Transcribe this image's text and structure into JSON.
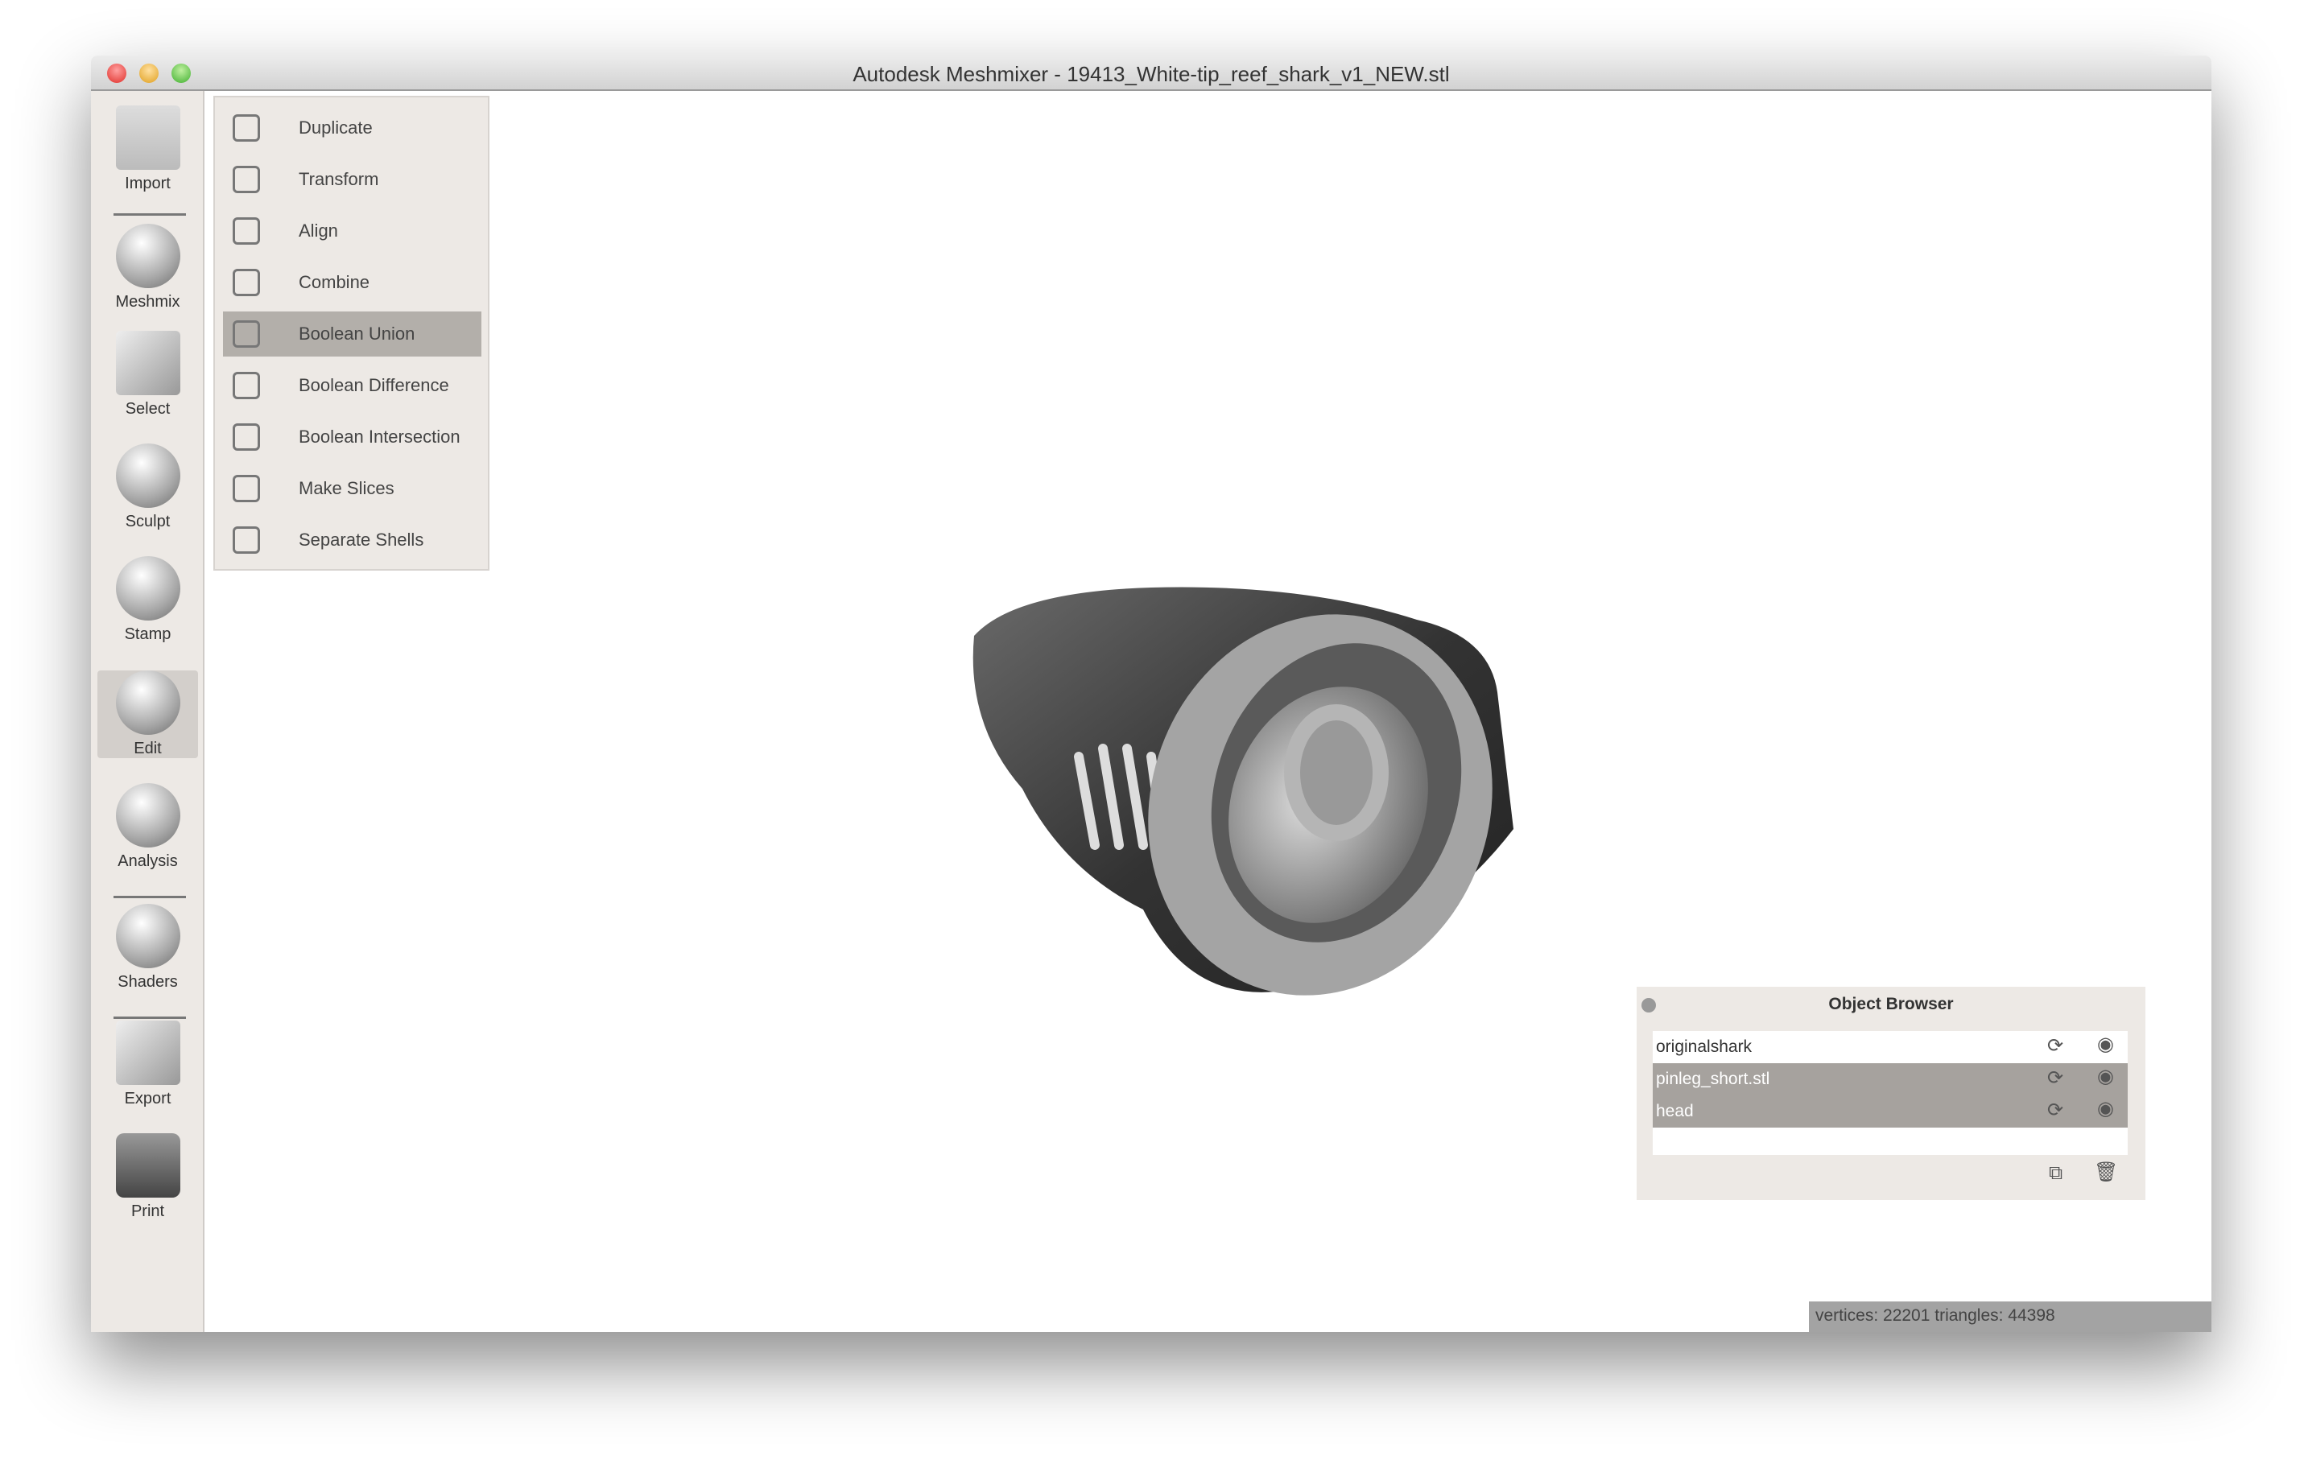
{
  "window": {
    "title": "Autodesk Meshmixer - 19413_White-tip_reef_shark_v1_NEW.stl"
  },
  "sidebar": {
    "items": [
      {
        "label": "Import",
        "icon": "plus-icon"
      },
      {
        "label": "Meshmix",
        "icon": "face-sphere-icon"
      },
      {
        "label": "Select",
        "icon": "arrow-pointer-icon"
      },
      {
        "label": "Sculpt",
        "icon": "brush-sphere-icon"
      },
      {
        "label": "Stamp",
        "icon": "stamp-sphere-icon"
      },
      {
        "label": "Edit",
        "icon": "edit-sphere-icon",
        "selected": true
      },
      {
        "label": "Analysis",
        "icon": "analysis-sphere-icon"
      },
      {
        "label": "Shaders",
        "icon": "shader-sphere-icon"
      },
      {
        "label": "Export",
        "icon": "export-icon"
      },
      {
        "label": "Print",
        "icon": "printer-icon"
      }
    ]
  },
  "edit_menu": {
    "items": [
      {
        "label": "Duplicate",
        "icon": "duplicate-icon"
      },
      {
        "label": "Transform",
        "icon": "transform-icon"
      },
      {
        "label": "Align",
        "icon": "align-icon"
      },
      {
        "label": "Combine",
        "icon": "combine-icon"
      },
      {
        "label": "Boolean Union",
        "icon": "boolean-union-icon",
        "hovered": true
      },
      {
        "label": "Boolean Difference",
        "icon": "boolean-difference-icon"
      },
      {
        "label": "Boolean Intersection",
        "icon": "boolean-intersection-icon"
      },
      {
        "label": "Make Slices",
        "icon": "slices-icon"
      },
      {
        "label": "Separate Shells",
        "icon": "separate-shells-icon"
      }
    ]
  },
  "object_browser": {
    "title": "Object Browser",
    "objects": [
      {
        "name": "originalshark",
        "selected": false
      },
      {
        "name": "pinleg_short.stl",
        "selected": true
      },
      {
        "name": "head",
        "selected": true
      }
    ]
  },
  "status": {
    "text": "vertices: 22201 triangles: 44398"
  },
  "colors": {
    "selection": "#a6a29e",
    "menu_hover": "#b3afaa",
    "panel": "#ede9e5"
  }
}
